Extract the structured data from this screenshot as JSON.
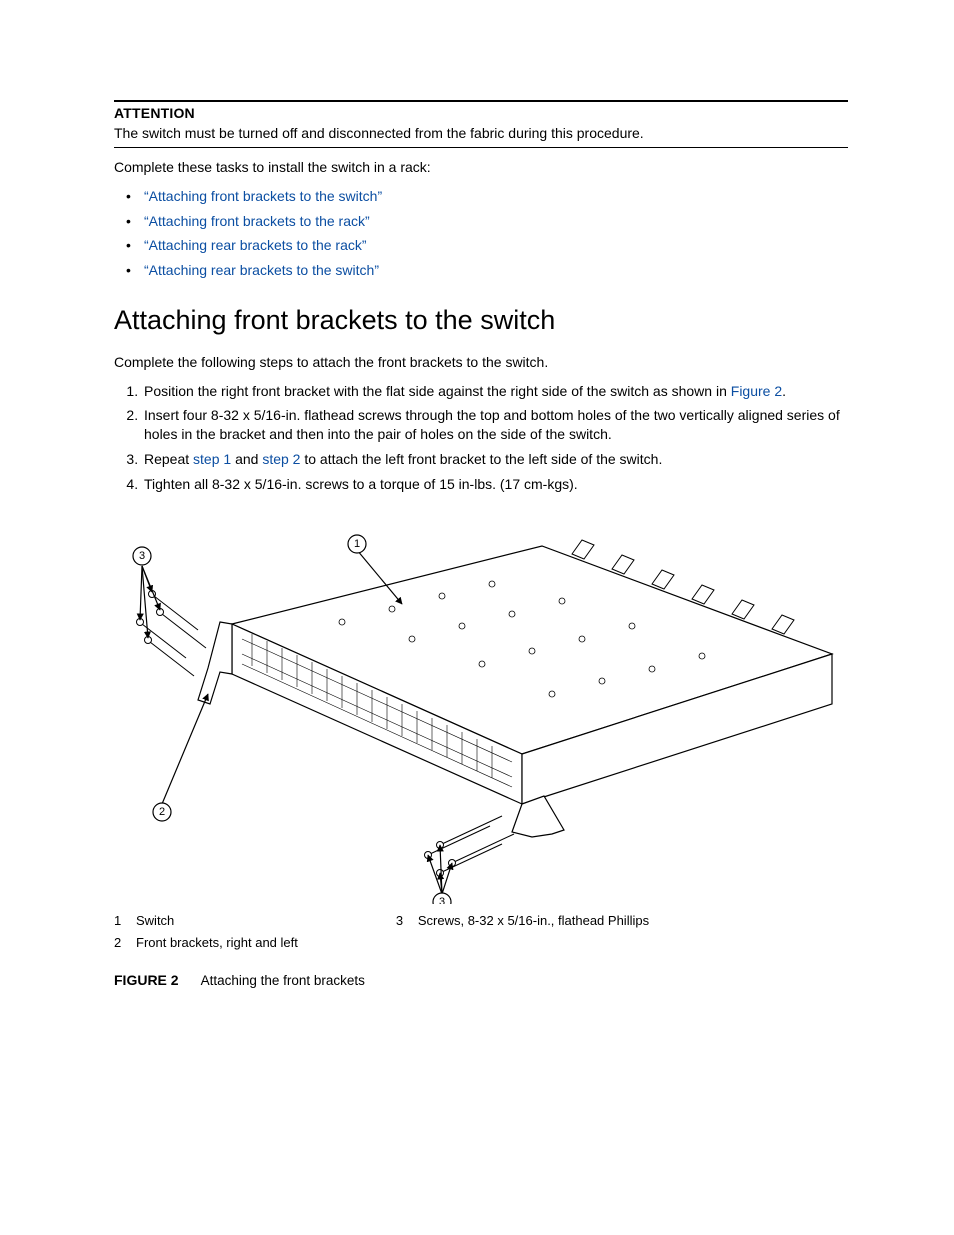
{
  "attention": {
    "label": "ATTENTION",
    "text": "The switch must be turned off and disconnected from the fabric during this procedure."
  },
  "intro": "Complete these tasks to install the switch in a rack:",
  "tasks": [
    "“Attaching front brackets to the switch”",
    "“Attaching front brackets to the rack”",
    "“Attaching rear brackets to the rack”",
    "“Attaching rear brackets to the switch”"
  ],
  "section": {
    "title": "Attaching front brackets to the switch",
    "intro": "Complete the following steps to attach the front brackets to the switch.",
    "steps": {
      "s1_a": "Position the right front bracket with the flat side against the right side of the switch as shown in ",
      "s1_link": "Figure 2",
      "s1_b": ".",
      "s2": "Insert four 8-32 x 5/16-in. flathead screws through the top and bottom holes of the two vertically aligned series of holes in the bracket and then into the pair of holes on the side of the switch.",
      "s3_a": "Repeat ",
      "s3_link1": "step 1",
      "s3_mid": " and ",
      "s3_link2": "step 2",
      "s3_b": " to attach the left front bracket to the left side of the switch.",
      "s4": "Tighten all 8-32 x 5/16-in. screws to a torque of 15 in-lbs. (17 cm-kgs)."
    }
  },
  "figure": {
    "label": "FIGURE 2",
    "caption": "Attaching the front brackets",
    "callouts": {
      "c1": "1",
      "c2": "2",
      "c3": "3"
    },
    "legend": [
      {
        "n": "1",
        "t": "Switch"
      },
      {
        "n": "2",
        "t": "Front brackets, right and left"
      },
      {
        "n": "3",
        "t": "Screws, 8-32 x 5/16-in., flathead Phillips"
      }
    ]
  }
}
